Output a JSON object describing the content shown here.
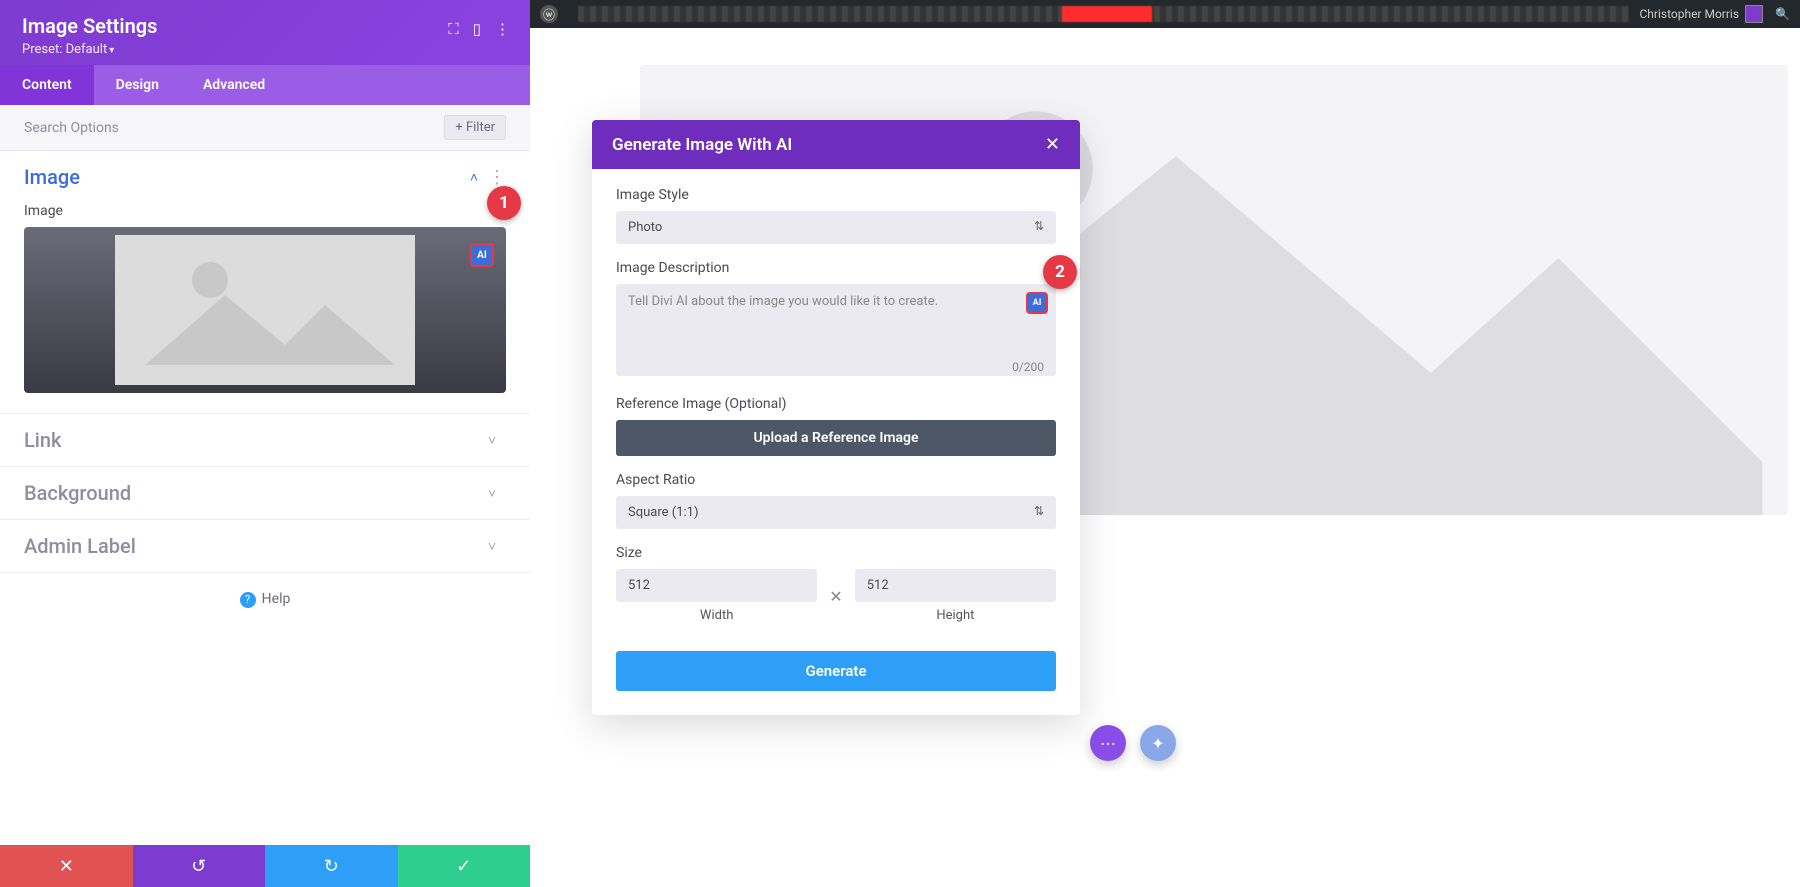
{
  "sidebar": {
    "title": "Image Settings",
    "preset_label": "Preset: Default",
    "tabs": {
      "content": "Content",
      "design": "Design",
      "advanced": "Advanced"
    },
    "search_placeholder": "Search Options",
    "filter_label": "Filter",
    "sections": {
      "image_title": "Image",
      "image_field_label": "Image",
      "link_title": "Link",
      "background_title": "Background",
      "admin_label_title": "Admin Label"
    },
    "ai_badge": "AI",
    "help_label": "Help"
  },
  "wp_bar": {
    "user_name": "Christopher Morris"
  },
  "ai_modal": {
    "title": "Generate Image With AI",
    "style_label": "Image Style",
    "style_value": "Photo",
    "desc_label": "Image Description",
    "desc_placeholder": "Tell Divi AI about the image you would like it to create.",
    "char_count": "0/200",
    "ai_badge": "AI",
    "ref_label": "Reference Image (Optional)",
    "upload_label": "Upload a Reference Image",
    "ratio_label": "Aspect Ratio",
    "ratio_value": "Square (1:1)",
    "size_label": "Size",
    "width_value": "512",
    "height_value": "512",
    "width_label": "Width",
    "height_label": "Height",
    "generate_label": "Generate"
  },
  "callouts": {
    "one": "1",
    "two": "2"
  }
}
